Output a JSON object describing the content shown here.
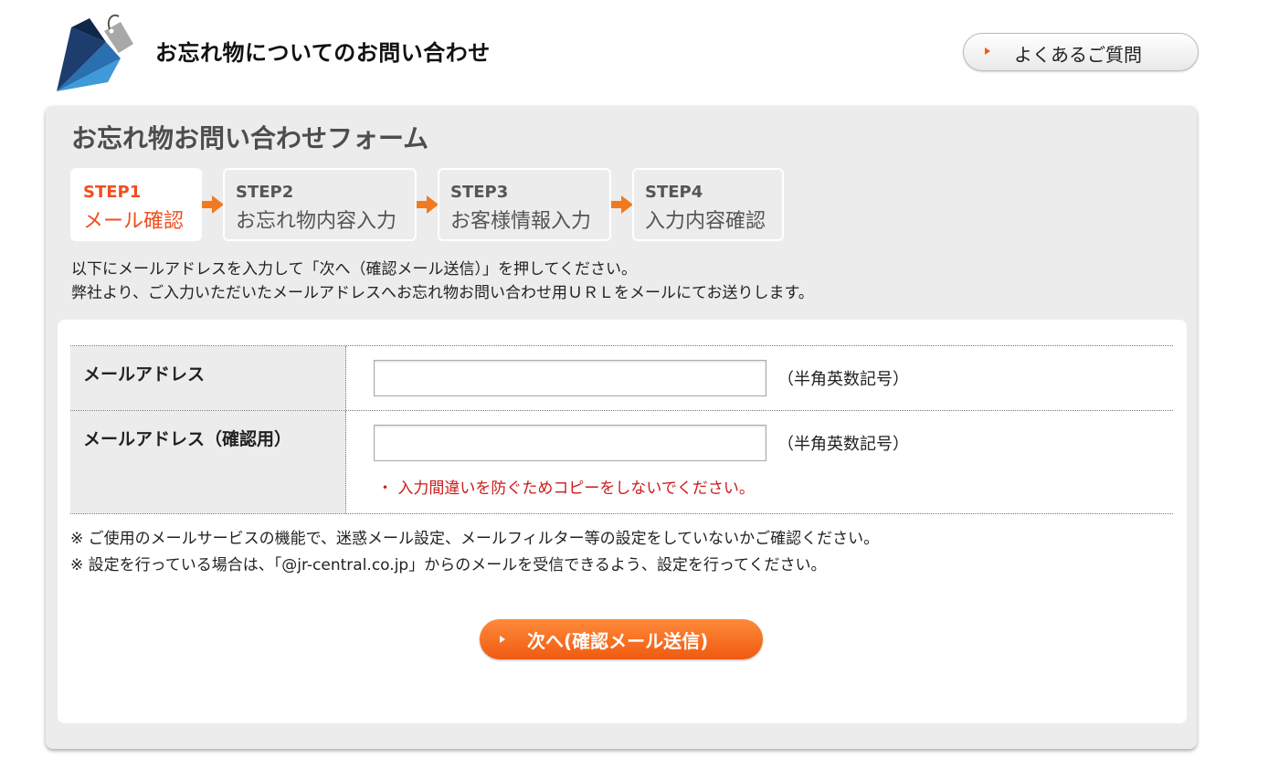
{
  "header": {
    "title": "お忘れ物についてのお問い合わせ",
    "faq_label": "よくあるご質問"
  },
  "form": {
    "title": "お忘れ物お問い合わせフォーム",
    "steps": [
      {
        "num": "STEP1",
        "name": "メール確認",
        "active": true
      },
      {
        "num": "STEP2",
        "name": "お忘れ物内容入力",
        "active": false
      },
      {
        "num": "STEP3",
        "name": "お客様情報入力",
        "active": false
      },
      {
        "num": "STEP4",
        "name": "入力内容確認",
        "active": false
      }
    ],
    "intro": [
      "以下にメールアドレスを入力して「次へ（確認メール送信）」を押してください。",
      "弊社より、ご入力いただいたメールアドレスへお忘れ物お問い合わせ用ＵＲＬをメールにてお送りします。"
    ],
    "fields": {
      "email": {
        "label": "メールアドレス",
        "value": "",
        "hint": "（半角英数記号）"
      },
      "email_confirm": {
        "label": "メールアドレス（確認用）",
        "value": "",
        "hint": "（半角英数記号）",
        "warning": "・ 入力間違いを防ぐためコピーをしないでください。"
      }
    },
    "notes": [
      "※ ご使用のメールサービスの機能で、迷惑メール設定、メールフィルター等の設定をしていないかご確認ください。",
      "※ 設定を行っている場合は、「@jr-central.co.jp」からのメールを受信できるよう、設定を行ってください。"
    ],
    "next_label": "次へ(確認メール送信)"
  },
  "colors": {
    "accent": "#f04e1e",
    "button_orange": "#f05a10",
    "panel_bg": "#ececec",
    "warning_red": "#cc1a1a"
  },
  "icons": {
    "logo": "umbrella-tag-logo-icon",
    "faq": "chevron-right-icon",
    "step_arrow": "arrow-right-icon",
    "next": "chevron-right-icon"
  }
}
